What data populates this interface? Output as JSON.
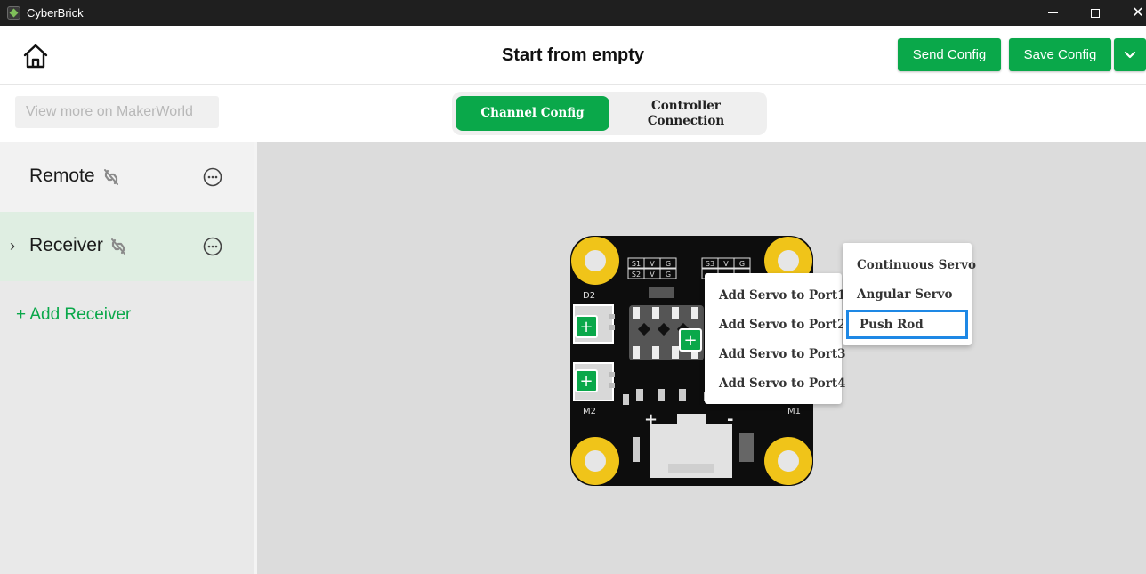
{
  "window": {
    "title": "CyberBrick",
    "controls": [
      "minimize",
      "maximize",
      "close"
    ]
  },
  "header": {
    "title": "Start from empty",
    "send_label": "Send Config",
    "save_label": "Save Config",
    "dropdown_icon": "chevron-down-icon",
    "home_icon": "home-icon"
  },
  "subheader": {
    "makerworld_label": "View more on MakerWorld",
    "tabs": [
      {
        "label": "Channel Config",
        "active": true
      },
      {
        "label": "Controller Connection",
        "active": false
      }
    ]
  },
  "sidebar": {
    "items": [
      {
        "label": "Remote",
        "status_icon": "link-off-icon",
        "expanded": false
      },
      {
        "label": "Receiver",
        "status_icon": "link-off-icon",
        "expanded": true,
        "chevron": "›"
      }
    ],
    "add_label": "+ Add Receiver"
  },
  "board": {
    "labels": {
      "d2": "D2",
      "m2": "M2",
      "m1": "M1",
      "s1": "S1",
      "s2": "S2",
      "s3": "S3",
      "v": "V",
      "g": "G",
      "plus": "+",
      "minus": "-"
    },
    "add_buttons": [
      "+",
      "+",
      "+"
    ]
  },
  "port_menu": {
    "items": [
      "Add Servo to Port1",
      "Add Servo to Port2",
      "Add Servo to Port3",
      "Add Servo to Port4"
    ]
  },
  "type_menu": {
    "items": [
      "Continuous Servo",
      "Angular Servo",
      "Push Rod"
    ],
    "selected": "Push Rod"
  },
  "colors": {
    "accent": "#0aa84a",
    "selection": "#1e88e5",
    "board": "#0d0d0d",
    "mount_hole": "#f0c419"
  }
}
